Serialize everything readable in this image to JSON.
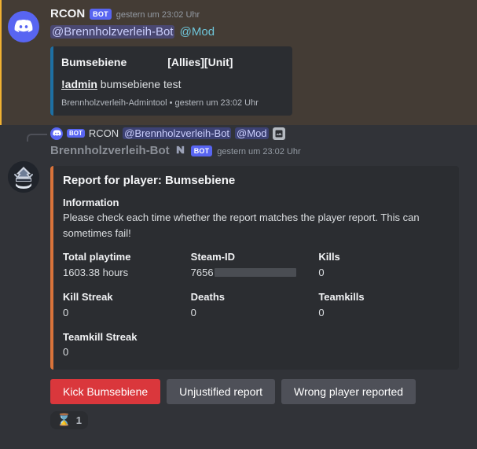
{
  "message_mention": {
    "author": "RCON",
    "bot_badge": "BOT",
    "timestamp": "gestern um 23:02 Uhr",
    "content_mentions": {
      "user": "@Brennholzverleih-Bot",
      "role": "@Mod"
    },
    "embed": {
      "accent_color": "#1d6fa3",
      "player_name": "Bumsebiene",
      "tags": "[Allies][Unit]",
      "command": "!admin",
      "command_args": "bumsebiene test",
      "footer": "Brennholzverleih-Admintool • gestern um 23:02 Uhr"
    }
  },
  "message_report": {
    "reply_reference": {
      "bot_badge": "BOT",
      "author": "RCON",
      "mention_user": "@Brennholzverleih-Bot",
      "mention_role": "@Mod",
      "attachment_icon": "image-icon"
    },
    "author": "Brennholzverleih-Bot",
    "bot_badge": "BOT",
    "timestamp": "gestern um 23:02 Uhr",
    "embed": {
      "accent_color": "#d9733a",
      "title": "Report for player: Bumsebiene",
      "info_heading": "Information",
      "info_text": "Please check each time whether the report matches the player report. This can sometimes fail!",
      "fields": [
        {
          "name": "Total playtime",
          "value": "1603.38 hours",
          "redacted": false
        },
        {
          "name": "Steam-ID",
          "value": "7656",
          "redacted": true
        },
        {
          "name": "Kills",
          "value": "0",
          "redacted": false
        },
        {
          "name": "Kill Streak",
          "value": "0",
          "redacted": false
        },
        {
          "name": "Deaths",
          "value": "0",
          "redacted": false
        },
        {
          "name": "Teamkills",
          "value": "0",
          "redacted": false
        },
        {
          "name": "Teamkill Streak",
          "value": "0",
          "redacted": false
        }
      ]
    },
    "buttons": [
      {
        "label": "Kick Bumsebiene",
        "style": "danger"
      },
      {
        "label": "Unjustified report",
        "style": "secondary"
      },
      {
        "label": "Wrong player reported",
        "style": "secondary"
      }
    ],
    "reactions": [
      {
        "emoji": "⌛",
        "count": "1"
      }
    ]
  }
}
